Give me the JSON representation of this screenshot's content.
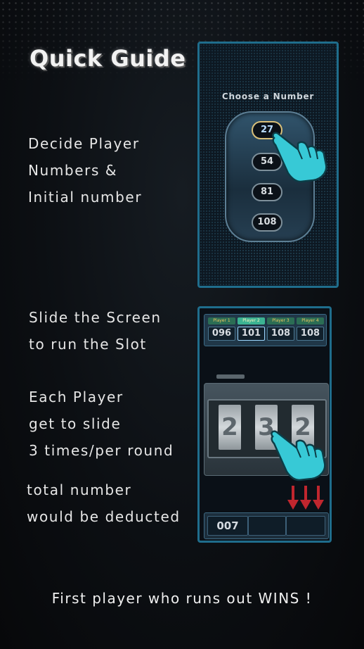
{
  "title": "Quick Guide",
  "sections": {
    "decide": [
      "Decide Player",
      "Numbers &",
      "Initial number"
    ],
    "slide": [
      "Slide the Screen",
      "to run the Slot"
    ],
    "each": [
      "Each Player",
      "get to slide",
      "3 times/per round"
    ],
    "deduct": [
      "total number",
      "would be deducted"
    ]
  },
  "footer": "First player who runs out WINS !",
  "panel1": {
    "heading": "Choose a Number",
    "options": [
      "27",
      "54",
      "81",
      "108"
    ],
    "selected": "27"
  },
  "panel2": {
    "players": [
      {
        "name": "Player 1",
        "score": "096"
      },
      {
        "name": "Player 2",
        "score": "101"
      },
      {
        "name": "Player 3",
        "score": "108"
      },
      {
        "name": "Player 4",
        "score": "108"
      }
    ],
    "reels": [
      "2",
      "3",
      "2"
    ],
    "total": "007"
  },
  "colors": {
    "accent": "#1f6d8c",
    "hand": "#37c9d6",
    "arrow": "#c0262e"
  }
}
